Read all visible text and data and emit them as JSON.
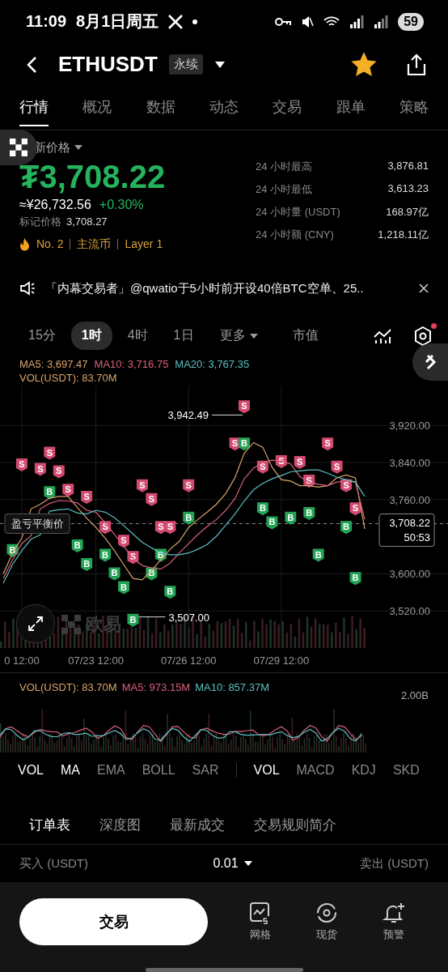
{
  "status_bar": {
    "time": "11:09",
    "date": "8月1日周五",
    "battery": "59"
  },
  "header": {
    "symbol": "ETHUSDT",
    "tag": "永续",
    "favorite": true
  },
  "tabs": [
    {
      "label": "行情",
      "selected": true
    },
    {
      "label": "概况",
      "selected": false
    },
    {
      "label": "数据",
      "selected": false
    },
    {
      "label": "动态",
      "selected": false
    },
    {
      "label": "交易",
      "selected": false
    },
    {
      "label": "跟单",
      "selected": false
    },
    {
      "label": "策略",
      "selected": false
    }
  ],
  "price": {
    "label": "新价格",
    "last": "₮3,708.22",
    "approx": "≈¥26,732.56",
    "change": "+0.30%",
    "mark_label": "标记价格",
    "mark": "3,708.27",
    "tags": [
      "No. 2",
      "主流币",
      "Layer 1"
    ]
  },
  "stats": [
    {
      "label": "24 小时最高",
      "value": "3,876.81"
    },
    {
      "label": "24 小时最低",
      "value": "3,613.23"
    },
    {
      "label": "24 小时量 (USDT)",
      "value": "168.97亿"
    },
    {
      "label": "24 小时额 (CNY)",
      "value": "1,218.11亿"
    }
  ],
  "notice": {
    "text": "「内幕交易者」@qwatio于5小时前开设40倍BTC空单、25.."
  },
  "intervals": [
    {
      "label": "15分",
      "selected": false,
      "kind": "plain"
    },
    {
      "label": "1时",
      "selected": true,
      "kind": "plain"
    },
    {
      "label": "4时",
      "selected": false,
      "kind": "plain"
    },
    {
      "label": "1日",
      "selected": false,
      "kind": "plain"
    },
    {
      "label": "更多",
      "selected": false,
      "kind": "menu"
    },
    {
      "label": "市值",
      "selected": false,
      "kind": "plain"
    }
  ],
  "settings": {
    "badge": true
  },
  "chart": {
    "legend_values": [
      ": 3,697.47",
      ": 3,716.75",
      ": 3,767.35"
    ],
    "vol_text": "VOL(USDT): 83.70M",
    "watermark": "欧易",
    "breakeven_label": "盈亏平衡价",
    "last_price": "3,708.22",
    "countdown": "50:53",
    "markers": [
      {
        "kind": "sell",
        "text": "S"
      },
      {
        "kind": "sell",
        "text": "S"
      },
      {
        "kind": "sell",
        "text": "S"
      },
      {
        "kind": "sell",
        "text": "S"
      },
      {
        "kind": "sell",
        "text": "S"
      },
      {
        "kind": "sell",
        "text": "S"
      },
      {
        "kind": "sell",
        "text": "S"
      },
      {
        "kind": "sell",
        "text": "S"
      },
      {
        "kind": "sell",
        "text": "S"
      },
      {
        "kind": "sell",
        "text": "S"
      },
      {
        "kind": "sell",
        "text": "S"
      },
      {
        "kind": "sell",
        "text": "S"
      },
      {
        "kind": "sell",
        "text": "S"
      },
      {
        "kind": "sell",
        "text": "S"
      },
      {
        "kind": "sell",
        "text": "S"
      },
      {
        "kind": "sell",
        "text": "S"
      },
      {
        "kind": "sell",
        "text": "S"
      },
      {
        "kind": "sell",
        "text": "S"
      },
      {
        "kind": "sell",
        "text": "S"
      },
      {
        "kind": "sell",
        "text": "S"
      },
      {
        "kind": "sell",
        "text": "S"
      },
      {
        "kind": "sell",
        "text": "S"
      },
      {
        "kind": "sell",
        "text": "S"
      },
      {
        "kind": "sell",
        "text": "S"
      },
      {
        "kind": "buy",
        "text": "B"
      },
      {
        "kind": "buy",
        "text": "B"
      },
      {
        "kind": "buy",
        "text": "B"
      },
      {
        "kind": "buy",
        "text": "B"
      },
      {
        "kind": "buy",
        "text": "B"
      },
      {
        "kind": "buy",
        "text": "B"
      },
      {
        "kind": "buy",
        "text": "B"
      },
      {
        "kind": "buy",
        "text": "B"
      },
      {
        "kind": "buy",
        "text": "B"
      },
      {
        "kind": "buy",
        "text": "B"
      },
      {
        "kind": "buy",
        "text": "B"
      },
      {
        "kind": "buy",
        "text": "B"
      },
      {
        "kind": "buy",
        "text": "B"
      },
      {
        "kind": "buy",
        "text": "B"
      },
      {
        "kind": "buy",
        "text": "B"
      },
      {
        "kind": "buy",
        "text": "B"
      },
      {
        "kind": "buy",
        "text": "B"
      },
      {
        "kind": "buy",
        "text": "B"
      },
      {
        "kind": "buy",
        "text": "B"
      },
      {
        "kind": "buy",
        "text": "B"
      }
    ],
    "chart_data": {
      "type": "line",
      "categories": [
        null,
        null,
        "0 12:00",
        null,
        null,
        null,
        null,
        null,
        null,
        null,
        "07/23 12:00",
        null,
        null,
        null,
        null,
        null,
        null,
        null,
        null,
        null,
        "07/26 12:00",
        null,
        null,
        null,
        null,
        null,
        null,
        null,
        null,
        null,
        "07/29 12:00",
        null,
        null,
        null,
        null,
        null,
        null,
        null,
        null,
        null
      ],
      "grid": true,
      "series": [
        {
          "name": "MA5",
          "color": "#d9a36a",
          "values": [
            3600,
            3645,
            3677,
            3740,
            3750,
            3763,
            3767,
            3767,
            3743,
            3720,
            3700,
            3677,
            3650,
            3620,
            3590,
            3587,
            3607,
            3630,
            3653,
            3670,
            3700,
            3717,
            3733,
            3750,
            3773,
            3807,
            3860,
            3883,
            3873,
            3830,
            3803,
            3800,
            3790,
            3790,
            3787,
            3790,
            3807,
            3813,
            3807,
            3697
          ]
        },
        {
          "name": "MA10",
          "color": "#d9607c",
          "values": [
            3590,
            3630,
            3665,
            3682,
            3740,
            3752,
            3758,
            3757,
            3753,
            3737,
            3733,
            3710,
            3685,
            3660,
            3633,
            3618,
            3613,
            3610,
            3623,
            3645,
            3665,
            3685,
            3702,
            3717,
            3737,
            3762,
            3805,
            3828,
            3840,
            3845,
            3843,
            3837,
            3810,
            3797,
            3793,
            3790,
            3798,
            3800,
            3798,
            3717
          ]
        },
        {
          "name": "MA20",
          "color": "#5bbfc0",
          "values": [
            3580,
            3620,
            3650,
            3675,
            3684,
            3735,
            3738,
            3740,
            3731,
            3729,
            3737,
            3733,
            3721,
            3704,
            3686,
            3668,
            3656,
            3645,
            3641,
            3641,
            3645,
            3653,
            3663,
            3681,
            3705,
            3729,
            3757,
            3781,
            3795,
            3805,
            3812,
            3820,
            3822,
            3824,
            3824,
            3817,
            3808,
            3803,
            3798,
            3767
          ]
        }
      ],
      "ylim": [
        3440,
        4006
      ],
      "yticks": [
        {
          "value": 3520,
          "label": "3,520.00"
        },
        {
          "value": 3600,
          "label": "3,600.00"
        },
        {
          "value": 3760,
          "label": "3,760.00"
        },
        {
          "value": 3840,
          "label": "3,840.00"
        },
        {
          "value": 3920,
          "label": "3,920.00"
        }
      ],
      "annotations": [
        "3,942.49",
        "3,507.00"
      ]
    }
  },
  "volume": {
    "legend": [
      {
        "text": "VOL(USDT): 83.70M",
        "color": "#d9a36a"
      },
      {
        "text": "MA5: 973.15M",
        "color": "#d9607c"
      },
      {
        "text": "MA10: 857.37M",
        "color": "#5bbfc0"
      }
    ],
    "scale": "2.00B"
  },
  "indicators": {
    "main": [
      {
        "label": "VOL",
        "selected": true
      },
      {
        "label": "MA",
        "selected": true
      },
      {
        "label": "EMA",
        "selected": false
      },
      {
        "label": "BOLL",
        "selected": false
      },
      {
        "label": "SAR",
        "selected": false
      }
    ],
    "sub": [
      {
        "label": "VOL",
        "selected": true
      },
      {
        "label": "MACD",
        "selected": false
      },
      {
        "label": "KDJ",
        "selected": false
      },
      {
        "label": "SKD",
        "selected": false
      }
    ]
  },
  "order_tabs": [
    {
      "label": "订单表",
      "selected": true
    },
    {
      "label": "深度图",
      "selected": false
    },
    {
      "label": "最新成交",
      "selected": false
    },
    {
      "label": "交易规则简介",
      "selected": false
    }
  ],
  "order_book": {
    "buy": "买入 (USDT)",
    "step": "0.01",
    "sell": "卖出 (USDT)"
  },
  "bottom_bar": {
    "trade": "交易",
    "actions": [
      {
        "label": "网格",
        "kind": "grid"
      },
      {
        "label": "现货",
        "kind": "spot"
      },
      {
        "label": "预警",
        "kind": "alert"
      }
    ]
  }
}
